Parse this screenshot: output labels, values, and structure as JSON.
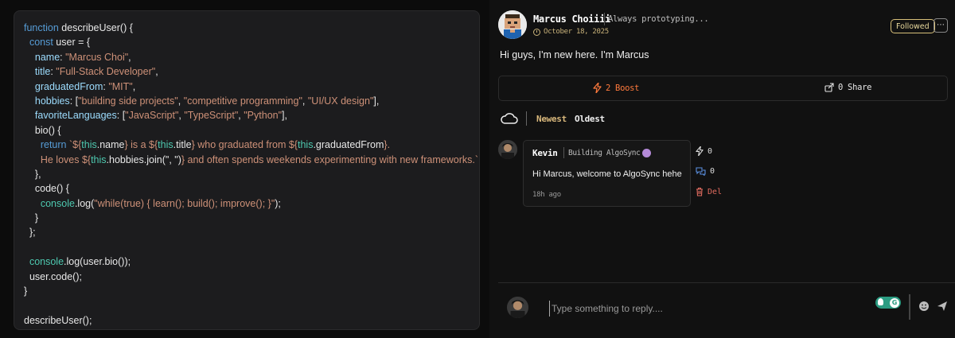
{
  "code": {
    "lines": [
      [
        {
          "t": "function ",
          "c": "kw"
        },
        {
          "t": "describeUser",
          "c": "plain"
        },
        {
          "t": "() {",
          "c": "plain"
        }
      ],
      [
        {
          "t": "  const ",
          "c": "kw"
        },
        {
          "t": "user = {",
          "c": "plain"
        }
      ],
      [
        {
          "t": "    name",
          "c": "prop"
        },
        {
          "t": ": ",
          "c": "plain"
        },
        {
          "t": "\"Marcus Choi\"",
          "c": "str"
        },
        {
          "t": ",",
          "c": "plain"
        }
      ],
      [
        {
          "t": "    title",
          "c": "prop"
        },
        {
          "t": ": ",
          "c": "plain"
        },
        {
          "t": "\"Full-Stack Developer\"",
          "c": "str"
        },
        {
          "t": ",",
          "c": "plain"
        }
      ],
      [
        {
          "t": "    graduatedFrom",
          "c": "prop"
        },
        {
          "t": ": ",
          "c": "plain"
        },
        {
          "t": "\"MIT\"",
          "c": "str"
        },
        {
          "t": ",",
          "c": "plain"
        }
      ],
      [
        {
          "t": "    hobbies",
          "c": "prop"
        },
        {
          "t": ": [",
          "c": "plain"
        },
        {
          "t": "\"building side projects\"",
          "c": "str"
        },
        {
          "t": ", ",
          "c": "plain"
        },
        {
          "t": "\"competitive programming\"",
          "c": "str"
        },
        {
          "t": ", ",
          "c": "plain"
        },
        {
          "t": "\"UI/UX design\"",
          "c": "str"
        },
        {
          "t": "],",
          "c": "plain"
        }
      ],
      [
        {
          "t": "    favoriteLanguages",
          "c": "prop"
        },
        {
          "t": ": [",
          "c": "plain"
        },
        {
          "t": "\"JavaScript\"",
          "c": "str"
        },
        {
          "t": ", ",
          "c": "plain"
        },
        {
          "t": "\"TypeScript\"",
          "c": "str"
        },
        {
          "t": ", ",
          "c": "plain"
        },
        {
          "t": "\"Python\"",
          "c": "str"
        },
        {
          "t": "],",
          "c": "plain"
        }
      ],
      [
        {
          "t": "    bio",
          "c": "plain"
        },
        {
          "t": "() {",
          "c": "plain"
        }
      ],
      [
        {
          "t": "      return ",
          "c": "kw"
        },
        {
          "t": "`${",
          "c": "str"
        },
        {
          "t": "this",
          "c": "cls"
        },
        {
          "t": ".name",
          "c": "plain"
        },
        {
          "t": "} is a ${",
          "c": "str"
        },
        {
          "t": "this",
          "c": "cls"
        },
        {
          "t": ".title",
          "c": "plain"
        },
        {
          "t": "} who graduated from ${",
          "c": "str"
        },
        {
          "t": "this",
          "c": "cls"
        },
        {
          "t": ".graduatedFrom",
          "c": "plain"
        },
        {
          "t": "}.",
          "c": "str"
        }
      ],
      [
        {
          "t": "      He loves ${",
          "c": "str"
        },
        {
          "t": "this",
          "c": "cls"
        },
        {
          "t": ".hobbies.join(\", \")",
          "c": "plain"
        },
        {
          "t": "} and often spends weekends experimenting with new frameworks.`",
          "c": "str"
        },
        {
          "t": ";",
          "c": "plain"
        }
      ],
      [
        {
          "t": "    },",
          "c": "plain"
        }
      ],
      [
        {
          "t": "    code",
          "c": "plain"
        },
        {
          "t": "() {",
          "c": "plain"
        }
      ],
      [
        {
          "t": "      console",
          "c": "cls"
        },
        {
          "t": ".log(",
          "c": "plain"
        },
        {
          "t": "\"while(true) { learn(); build(); improve(); }\"",
          "c": "str"
        },
        {
          "t": ");",
          "c": "plain"
        }
      ],
      [
        {
          "t": "    }",
          "c": "plain"
        }
      ],
      [
        {
          "t": "  };",
          "c": "plain"
        }
      ],
      [
        {
          "t": "",
          "c": "plain"
        }
      ],
      [
        {
          "t": "  console",
          "c": "cls"
        },
        {
          "t": ".log(user.bio());",
          "c": "plain"
        }
      ],
      [
        {
          "t": "  user.code();",
          "c": "plain"
        }
      ],
      [
        {
          "t": "}",
          "c": "plain"
        }
      ],
      [
        {
          "t": "",
          "c": "plain"
        }
      ],
      [
        {
          "t": "describeUser();",
          "c": "plain"
        }
      ]
    ]
  },
  "post": {
    "author_name": "Marcus Choiiii",
    "author_tagline": "Always prototyping...",
    "date": "October 18, 2025",
    "follow_label": "Followed",
    "more_label": "⋯",
    "content": "Hi guys, I'm new here. I'm Marcus",
    "boost_label": "2 Boost",
    "share_label": "0 Share"
  },
  "comments_sort": {
    "newest_label": "Newest",
    "oldest_label": "Oldest"
  },
  "comment": {
    "author": "Kevin",
    "tagline": "Building AlgoSync",
    "text": "Hi Marcus, welcome to AlgoSync hehe",
    "time": "18h ago",
    "like_count": "0",
    "reply_count": "0",
    "delete_label": "Del"
  },
  "reply": {
    "placeholder": "Type something to reply...."
  },
  "colors": {
    "accent_gold": "#d9b87c",
    "boost_orange": "#ff7a3d",
    "delete_red": "#e06b5f",
    "grammarly_green": "#2b9c82"
  }
}
